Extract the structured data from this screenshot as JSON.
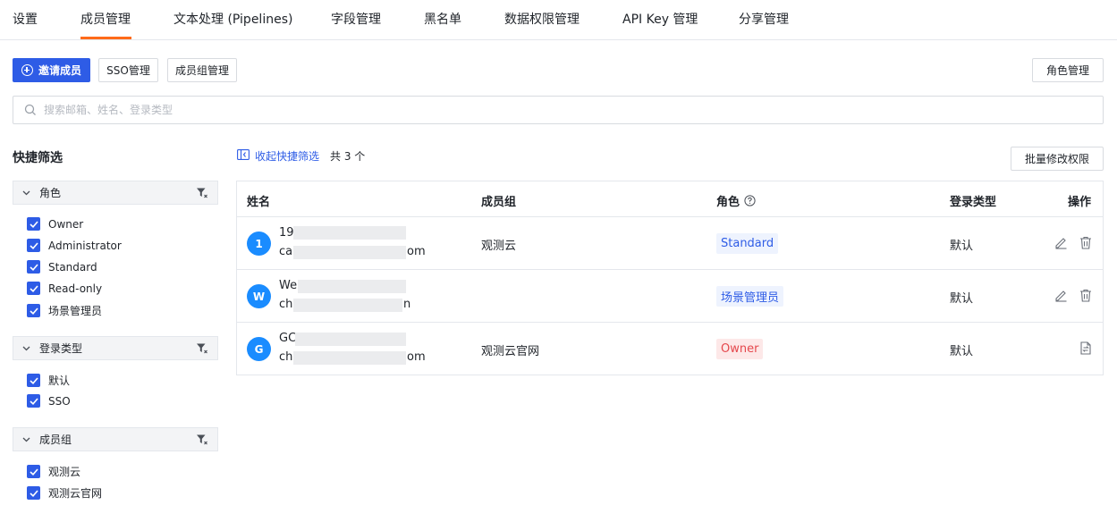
{
  "tabs": [
    {
      "label": "设置"
    },
    {
      "label": "成员管理"
    },
    {
      "label": "文本处理 (Pipelines)"
    },
    {
      "label": "字段管理"
    },
    {
      "label": "黑名单"
    },
    {
      "label": "数据权限管理"
    },
    {
      "label": "API Key 管理"
    },
    {
      "label": "分享管理"
    }
  ],
  "active_tab": "成员管理",
  "toolbar": {
    "invite_label": "邀请成员",
    "sso_label": "SSO管理",
    "group_label": "成员组管理",
    "role_label": "角色管理"
  },
  "search": {
    "placeholder": "搜索邮箱、姓名、登录类型",
    "value": ""
  },
  "quick_filter": {
    "title": "快捷筛选",
    "groups": [
      {
        "title": "角色",
        "options": [
          "Owner",
          "Administrator",
          "Standard",
          "Read-only",
          "场景管理员"
        ]
      },
      {
        "title": "登录类型",
        "options": [
          "默认",
          "SSO"
        ]
      },
      {
        "title": "成员组",
        "options": [
          "观测云",
          "观测云官网"
        ]
      }
    ]
  },
  "list": {
    "collapse_label": "收起快捷筛选",
    "count_label": "共 3 个",
    "batch_label": "批量修改权限",
    "columns": {
      "name": "姓名",
      "group": "成员组",
      "role": "角色",
      "login": "登录类型",
      "actions": "操作"
    },
    "rows": [
      {
        "avatar": "1",
        "name": "19",
        "email_start": "ca",
        "email_end": "om",
        "group": "观测云",
        "role": "Standard",
        "role_style": "blue",
        "login": "默认",
        "actions": [
          "edit-icon",
          "delete-icon"
        ]
      },
      {
        "avatar": "W",
        "name": "We",
        "email_start": "ch",
        "email_end": "n",
        "group": "",
        "role": "场景管理员",
        "role_style": "blue",
        "login": "默认",
        "actions": [
          "edit-icon",
          "delete-icon"
        ]
      },
      {
        "avatar": "G",
        "name": "GC",
        "email_start": "ch",
        "email_end": "om",
        "group": "观测云官网",
        "role": "Owner",
        "role_style": "red",
        "login": "默认",
        "actions": [
          "transfer-icon"
        ]
      }
    ]
  },
  "colors": {
    "accent": "#2e5ce6",
    "tab_underline": "#ff6b1a",
    "avatar": "#1a8cff",
    "owner_badge": "#e5484d"
  }
}
